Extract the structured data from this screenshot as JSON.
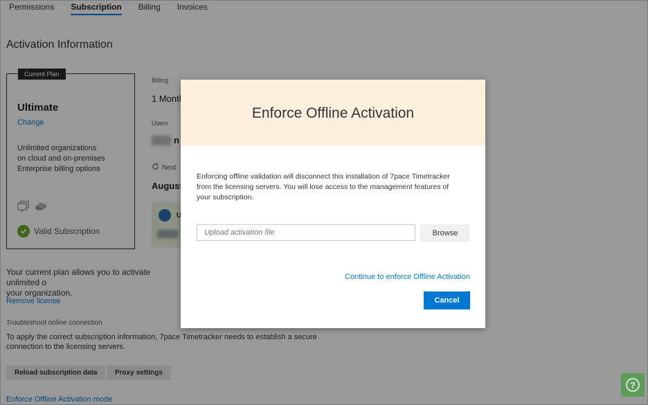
{
  "tabs": [
    {
      "label": "Permissions",
      "active": false
    },
    {
      "label": "Subscription",
      "active": true
    },
    {
      "label": "Billing",
      "active": false
    },
    {
      "label": "Invoices",
      "active": false
    }
  ],
  "section_title": "Activation Information",
  "plan": {
    "badge": "Current Plan",
    "name": "Ultimate",
    "change_label": "Change",
    "desc_lines": [
      "Unlimited organizations",
      "on cloud and on-premises",
      "Enterprise billing options"
    ],
    "valid_label": "Valid Subscription"
  },
  "billing": {
    "label": "Billing",
    "value": "1 Month",
    "users_label": "Users",
    "users_value_partial": "n",
    "next_label": "Next",
    "month_label": "August",
    "user_card_initial": "U"
  },
  "plan_text_lines": [
    "Your current plan allows you to activate unlimited o",
    "your organization."
  ],
  "remove_license_label": "Remove license",
  "troubleshoot_label": "Troubleshoot online connection",
  "apply_text_lines": [
    "To apply the correct subscription information, 7pace Timetracker needs to establish a secure",
    "connection to the licensing servers."
  ],
  "buttons": {
    "reload": "Reload subscription data",
    "proxy": "Proxy settings"
  },
  "enforce_link_label": "Enforce Offline Activation mode",
  "help_label": "?",
  "modal": {
    "title": "Enforce Offline Activation",
    "body_lines": [
      "Enforcing offline validation will disconnect this installation of 7pace Timetracker",
      "from the licensing servers. You will lose access to the management features of",
      "your subscription."
    ],
    "upload_placeholder": "Upload activation file",
    "browse_label": "Browse",
    "continue_label": "Continue to enforce Offline Activation",
    "cancel_label": "Cancel"
  },
  "colors": {
    "accent": "#0078d4",
    "modal_header": "#fcefdb",
    "valid_green": "#6aa829",
    "help_green": "#5d9b5a"
  }
}
